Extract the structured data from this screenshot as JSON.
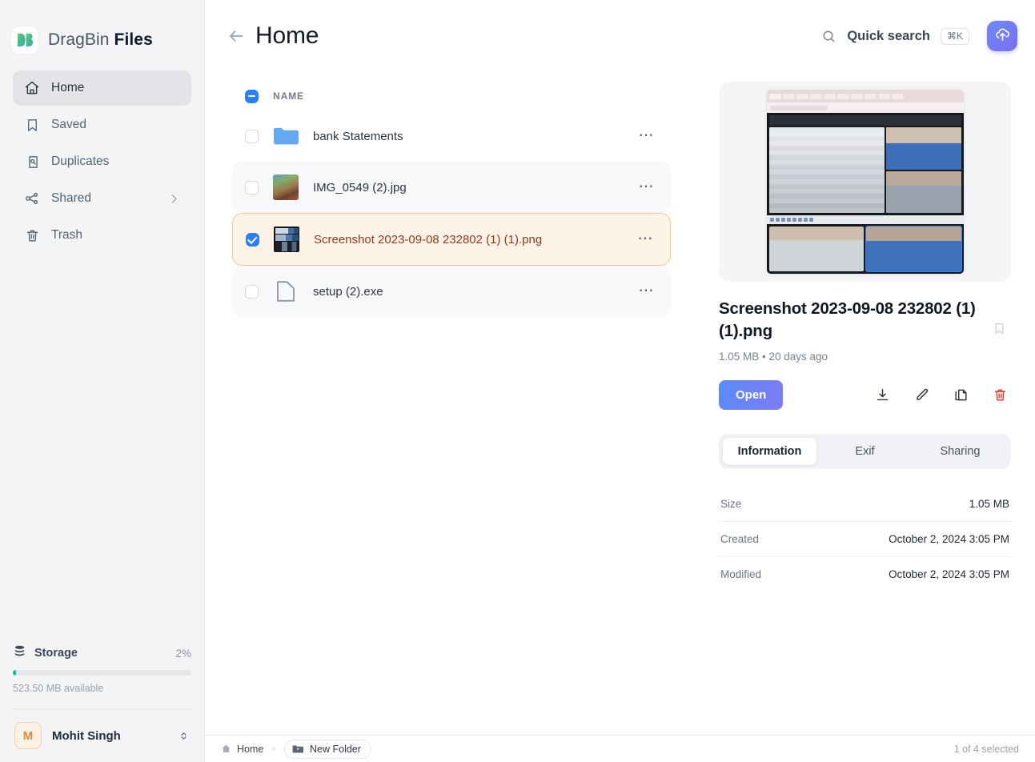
{
  "brand": {
    "name_light": "DragBin",
    "name_bold": "Files",
    "logo_icon": "dragbin-logo"
  },
  "sidebar": {
    "items": [
      {
        "label": "Home",
        "icon": "home-icon",
        "active": true,
        "chevron": false
      },
      {
        "label": "Saved",
        "icon": "bookmark-icon",
        "active": false,
        "chevron": false
      },
      {
        "label": "Duplicates",
        "icon": "duplicates-icon",
        "active": false,
        "chevron": false
      },
      {
        "label": "Shared",
        "icon": "share-nodes-icon",
        "active": false,
        "chevron": true
      },
      {
        "label": "Trash",
        "icon": "trash-icon",
        "active": false,
        "chevron": false
      }
    ],
    "storage": {
      "label": "Storage",
      "percent_label": "2%",
      "percent_value": 2,
      "available": "523.50 MB available",
      "bar_color": "#0bbf96",
      "icon": "database-icon"
    },
    "user": {
      "initial": "M",
      "name": "Mohit Singh",
      "switch_icon": "chevron-up-down-icon"
    }
  },
  "header": {
    "back_icon": "arrow-left-icon",
    "title": "Home",
    "search": {
      "icon": "search-icon",
      "label": "Quick search",
      "shortcut": "⌘K"
    },
    "upload": {
      "icon": "cloud-upload-icon",
      "color": "#6d7cf2"
    }
  },
  "filelist": {
    "select_all_state": "indeterminate",
    "column_header": "NAME",
    "rows": [
      {
        "name": "bank Statements",
        "type": "folder",
        "icon": "folder-icon",
        "checked": false,
        "selected": false,
        "zebra": false,
        "menu_icon": "ellipsis-icon"
      },
      {
        "name": "IMG_0549 (2).jpg",
        "type": "image",
        "icon": "photo-thumbnail",
        "checked": false,
        "selected": false,
        "zebra": true,
        "menu_icon": "ellipsis-icon"
      },
      {
        "name": "Screenshot 2023-09-08 232802 (1) (1).png",
        "type": "image",
        "icon": "screenshot-thumbnail",
        "checked": true,
        "selected": true,
        "zebra": false,
        "menu_icon": "ellipsis-icon"
      },
      {
        "name": "setup (2).exe",
        "type": "file",
        "icon": "file-icon",
        "checked": false,
        "selected": false,
        "zebra": true,
        "menu_icon": "ellipsis-icon"
      }
    ]
  },
  "details": {
    "preview_alt": "Screenshot of a video meeting with two participants and a shared screen",
    "file_name": "Screenshot 2023-09-08 232802 (1) (1).png",
    "meta": "1.05 MB • 20 days ago",
    "bookmark_icon": "bookmark-outline-icon",
    "open_label": "Open",
    "action_icons": [
      {
        "name": "download-icon",
        "danger": false
      },
      {
        "name": "edit-pencil-icon",
        "danger": false
      },
      {
        "name": "copy-icon",
        "danger": false
      },
      {
        "name": "trash-icon",
        "danger": true
      }
    ],
    "tabs": [
      {
        "label": "Information",
        "active": true
      },
      {
        "label": "Exif",
        "active": false
      },
      {
        "label": "Sharing",
        "active": false
      }
    ],
    "info": [
      {
        "key": "Size",
        "value": "1.05 MB"
      },
      {
        "key": "Created",
        "value": "October 2, 2024 3:05 PM"
      },
      {
        "key": "Modified",
        "value": "October 2, 2024 3:05 PM"
      }
    ]
  },
  "statusbar": {
    "home_icon": "home-small-icon",
    "breadcrumb": "Home",
    "separator": "›",
    "new_folder": {
      "label": "New Folder",
      "icon": "folder-plus-icon"
    },
    "selection": "1 of 4 selected"
  }
}
